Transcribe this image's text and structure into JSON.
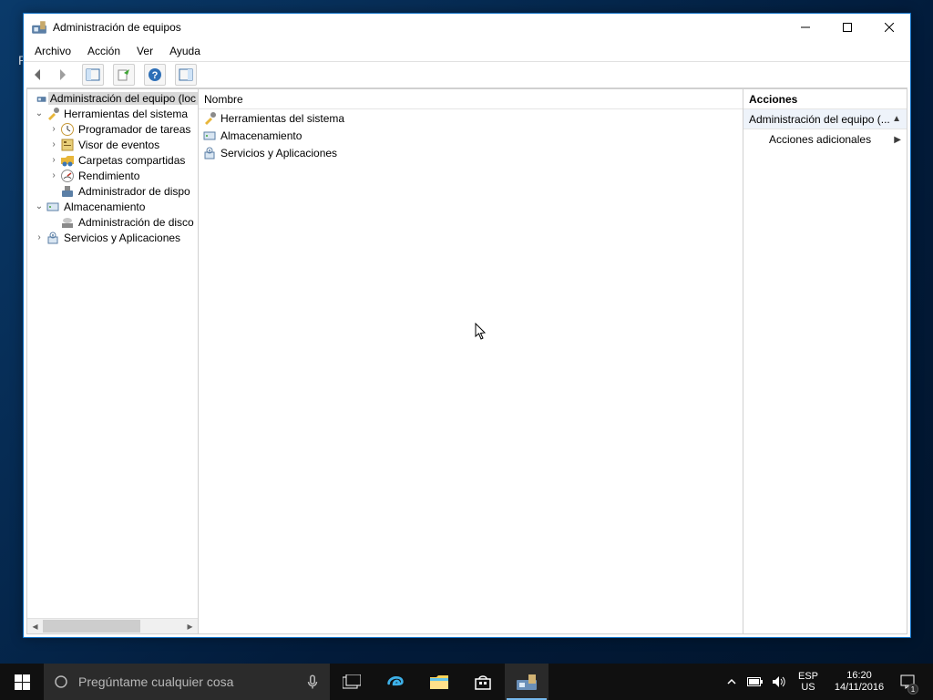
{
  "window": {
    "title": "Administración de equipos",
    "menu": {
      "archivo": "Archivo",
      "accion": "Acción",
      "ver": "Ver",
      "ayuda": "Ayuda"
    }
  },
  "tree": {
    "root": "Administración del equipo (loc",
    "herramientas": "Herramientas del sistema",
    "programador": "Programador de tareas",
    "visor": "Visor de eventos",
    "carpetas": "Carpetas compartidas",
    "rendimiento": "Rendimiento",
    "dispositivos": "Administrador de dispo",
    "almacenamiento": "Almacenamiento",
    "discos": "Administración de disco",
    "servicios": "Servicios y Aplicaciones"
  },
  "list": {
    "header": "Nombre",
    "herramientas": "Herramientas del sistema",
    "almacenamiento": "Almacenamiento",
    "servicios": "Servicios y Aplicaciones"
  },
  "actions": {
    "header": "Acciones",
    "group": "Administración del equipo (...",
    "adicionales": "Acciones adicionales"
  },
  "taskbar": {
    "search_placeholder": "Pregúntame cualquier cosa",
    "lang1": "ESP",
    "lang2": "US",
    "time": "16:20",
    "date": "14/11/2016",
    "notif_count": "1"
  }
}
